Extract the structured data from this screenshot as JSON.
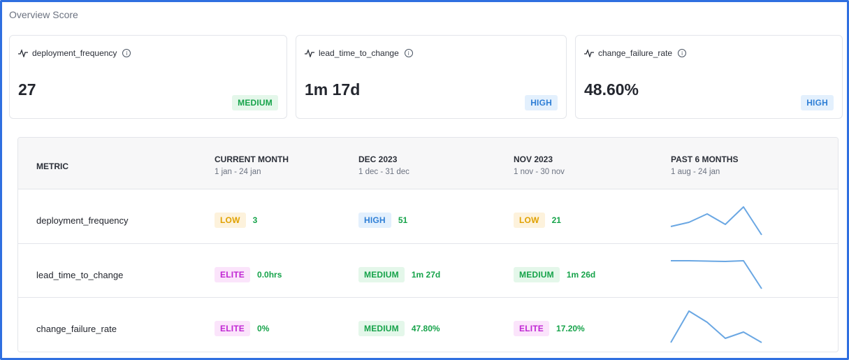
{
  "panel": {
    "title": "Overview Score"
  },
  "cards": [
    {
      "name": "deployment_frequency",
      "value": "27",
      "level": "MEDIUM"
    },
    {
      "name": "lead_time_to_change",
      "value": "1m 17d",
      "level": "HIGH"
    },
    {
      "name": "change_failure_rate",
      "value": "48.60%",
      "level": "HIGH"
    }
  ],
  "table": {
    "headers": [
      {
        "title": "METRIC",
        "sub": ""
      },
      {
        "title": "CURRENT MONTH",
        "sub": "1 jan - 24 jan"
      },
      {
        "title": "DEC 2023",
        "sub": "1 dec - 31 dec"
      },
      {
        "title": "NOV 2023",
        "sub": "1 nov - 30 nov"
      },
      {
        "title": "PAST 6 MONTHS",
        "sub": "1 aug - 24 jan"
      }
    ],
    "rows": [
      {
        "metric": "deployment_frequency",
        "current": {
          "level": "LOW",
          "value": "3"
        },
        "dec": {
          "level": "HIGH",
          "value": "51"
        },
        "nov": {
          "level": "LOW",
          "value": "21"
        }
      },
      {
        "metric": "lead_time_to_change",
        "current": {
          "level": "ELITE",
          "value": "0.0hrs"
        },
        "dec": {
          "level": "MEDIUM",
          "value": "1m 27d"
        },
        "nov": {
          "level": "MEDIUM",
          "value": "1m 26d"
        }
      },
      {
        "metric": "change_failure_rate",
        "current": {
          "level": "ELITE",
          "value": "0%"
        },
        "dec": {
          "level": "MEDIUM",
          "value": "47.80%"
        },
        "nov": {
          "level": "ELITE",
          "value": "17.20%"
        }
      }
    ]
  },
  "colors": {
    "frame": "#2f6fe0",
    "sparkline": "#6aa7e3",
    "medium": "#16a34a",
    "high": "#2f7fd6",
    "low": "#e0a100",
    "elite": "#c026d3"
  }
}
